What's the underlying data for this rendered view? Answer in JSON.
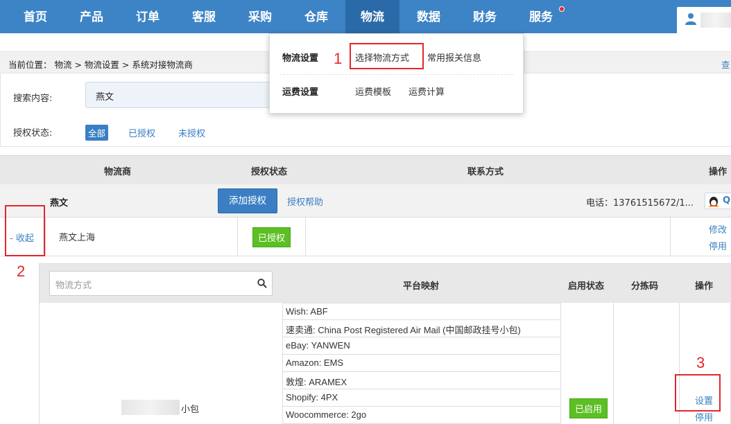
{
  "nav": {
    "items": [
      "首页",
      "产品",
      "订单",
      "客服",
      "采购",
      "仓库",
      "物流",
      "数据",
      "财务",
      "服务"
    ],
    "active": "物流"
  },
  "breadcrumb": {
    "text": "当前位置： 物流 > 物流设置 > 系统对接物流商",
    "right_link": "查"
  },
  "filter": {
    "search_label": "搜索内容:",
    "search_value": "燕文",
    "auth_label": "授权状态:",
    "auth_all": "全部",
    "auth_yes": "已授权",
    "auth_no": "未授权"
  },
  "dropdown": {
    "section1_title": "物流设置",
    "select_method": "选择物流方式",
    "customs_info": "常用报关信息",
    "section2_title": "运费设置",
    "freight_template": "运费模板",
    "freight_calc": "运费计算"
  },
  "table": {
    "headers": [
      "物流商",
      "授权状态",
      "联系方式",
      "操作"
    ],
    "carrier_name": "燕文",
    "add_auth": "添加授权",
    "auth_help": "授权帮助",
    "phone": "电话：13761515672/1...",
    "qq_label": "Q",
    "collapse": "- 收起",
    "sub_name": "燕文上海",
    "sub_status": "已授权",
    "sub_edit": "修改",
    "sub_disable": "停用"
  },
  "inner": {
    "method_placeholder": "物流方式",
    "headers": [
      "平台映射",
      "启用状态",
      "分拣码",
      "操作"
    ],
    "mappings": [
      "Wish:  ABF",
      "速卖通:  China Post Registered Air Mail (中国邮政挂号小包)",
      "eBay:  YANWEN",
      "Amazon:  EMS",
      "敦煌:  ARAMEX",
      "Shopify:  4PX",
      "Woocommerce:  2go"
    ],
    "method_name_suffix": "小包",
    "status": "已启用",
    "action_set": "设置",
    "action_disable": "停用"
  },
  "annotations": [
    "1",
    "2",
    "3"
  ],
  "colors": {
    "nav_bg": "#3d84c6",
    "nav_active": "#2a6aa8",
    "link": "#3a7fc3",
    "green_badge": "#5cbf24",
    "annotation_red": "#e3262a"
  }
}
